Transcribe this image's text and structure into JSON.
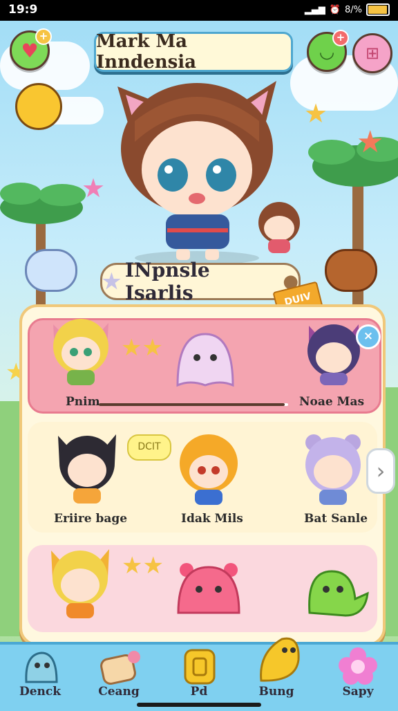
{
  "status_bar": {
    "time": "19:9",
    "battery_text": "8/%",
    "battery_level": 0.9
  },
  "header": {
    "title": "Mark Ma Inndensia"
  },
  "hero": {
    "name": "INpnsle Isarlis",
    "ribbon": "DUIV"
  },
  "cards": {
    "row1": {
      "left_label": "Pnim",
      "right_label": "Noae Mas",
      "progress": 0.98
    },
    "row2": {
      "bubble": "DCIT",
      "labels": [
        "Eriire bage",
        "Idak Mils",
        "Bat Sanle"
      ]
    }
  },
  "tabs": [
    {
      "label": "Denck",
      "icon": "dino-icon"
    },
    {
      "label": "Ceang",
      "icon": "bag-icon"
    },
    {
      "label": "Pd",
      "icon": "coin-icon"
    },
    {
      "label": "Bung",
      "icon": "chick-icon"
    },
    {
      "label": "Sapy",
      "icon": "flower-icon"
    }
  ],
  "colors": {
    "accent": "#4ea7cf",
    "card_pink": "#f4a4b0",
    "panel": "#fff8df",
    "tabbar": "#7fd0f0"
  }
}
